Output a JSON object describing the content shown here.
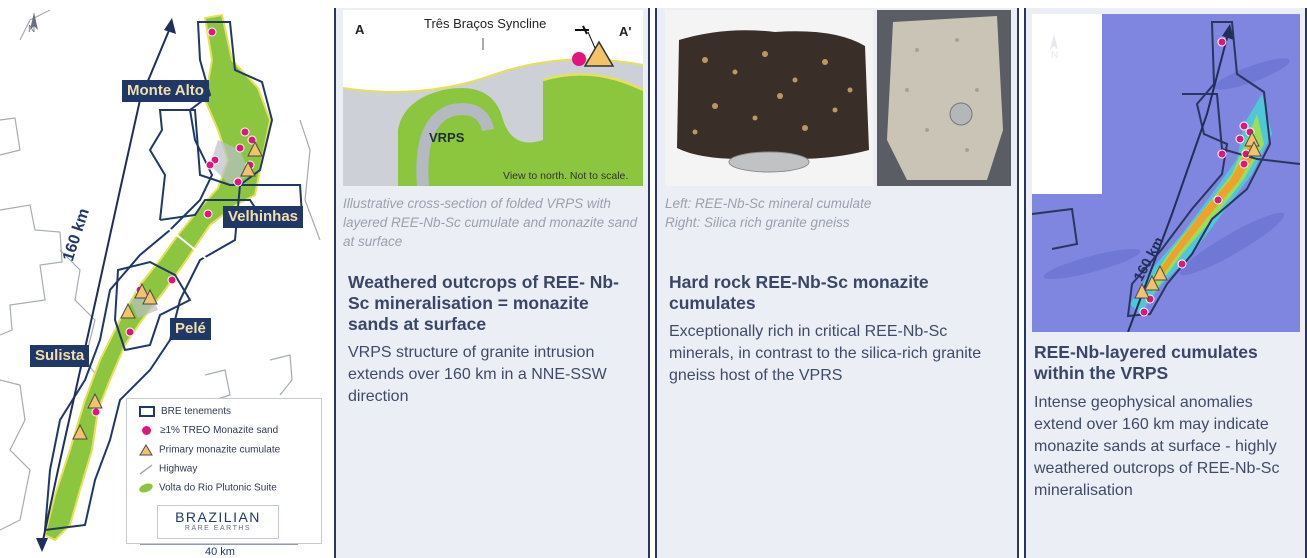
{
  "map1": {
    "north": "N",
    "distance_label": "160 km",
    "section_a": "A",
    "section_a_prime": "A'",
    "places": [
      "Monte Alto",
      "Velhinhas",
      "Pelé",
      "Sulista"
    ],
    "scale": "40 km",
    "legend": [
      {
        "icon": "tenement-box-icon",
        "label": "BRE tenements"
      },
      {
        "icon": "monazite-dot-icon",
        "label": "≥1% TREO Monazite sand"
      },
      {
        "icon": "triangle-icon",
        "label": "Primary monazite cumulate"
      },
      {
        "icon": "highway-line-icon",
        "label": "Highway"
      },
      {
        "icon": "suite-leaf-icon",
        "label": "Volta do Rio Plutonic Suite"
      }
    ],
    "logo_main": "BRAZILIAN",
    "logo_sub": "RARE EARTHS"
  },
  "panel1": {
    "xs_a": "A",
    "xs_title": "Três Braços Syncline",
    "xs_a_prime": "A'",
    "xs_unit": "VRPS",
    "xs_note": "View to north. Not to scale.",
    "caption": "Illustrative cross-section of folded VRPS with layered REE-Nb-Sc cumulate and monazite sand at surface",
    "heading": "Weathered outcrops of REE- Nb-Sc mineralisation = monazite sands at surface",
    "body": "VRPS structure of granite intrusion extends over 160 km in a NNE-SSW direction"
  },
  "panel2": {
    "caption_1": "Left: REE-Nb-Sc mineral cumulate",
    "caption_2": "Right: Silica rich granite gneiss",
    "heading": "Hard rock REE-Nb-Sc monazite cumulates",
    "body": "Exceptionally rich in critical REE-Nb-Sc minerals, in contrast to the silica-rich granite gneiss host of the VPRS"
  },
  "panel3": {
    "north": "N",
    "distance_label": "160 km",
    "heading": "REE-Nb-layered cumulates within the VRPS",
    "body": "Intense geophysical anomalies extend over 160 km may indicate monazite sands at surface - highly weathered outcrops of REE-Nb-Sc mineralisation"
  },
  "colors": {
    "navy": "#1f3868",
    "magenta": "#e0157e",
    "suite_green": "#8cc63f",
    "triangle_fill": "#f2c36b"
  }
}
